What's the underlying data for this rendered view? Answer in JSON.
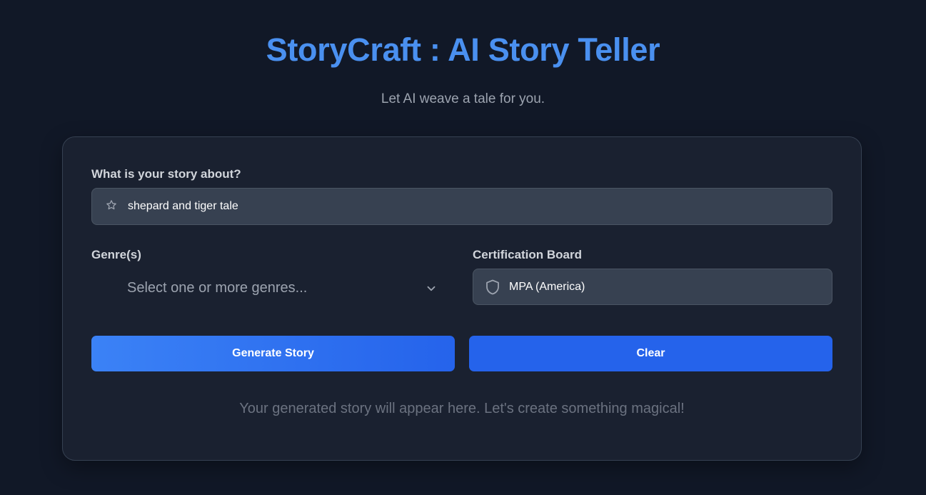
{
  "header": {
    "title": "StoryCraft : AI Story Teller",
    "subtitle": "Let AI weave a tale for you."
  },
  "form": {
    "story_label": "What is your story about?",
    "story_value": "shepard and tiger tale",
    "story_icon": "star-icon",
    "genre_label": "Genre(s)",
    "genre_placeholder": "Select one or more genres...",
    "genre_icon": "chevron-down-icon",
    "board_label": "Certification Board",
    "board_value": "MPA (America)",
    "board_icon": "shield-icon"
  },
  "actions": {
    "generate_label": "Generate Story",
    "clear_label": "Clear"
  },
  "output": {
    "placeholder": "Your generated story will appear here. Let's create something magical!"
  },
  "colors": {
    "background": "#111827",
    "card": "#1a2130",
    "accent": "#3b82f6",
    "title": "#4a90f0"
  }
}
